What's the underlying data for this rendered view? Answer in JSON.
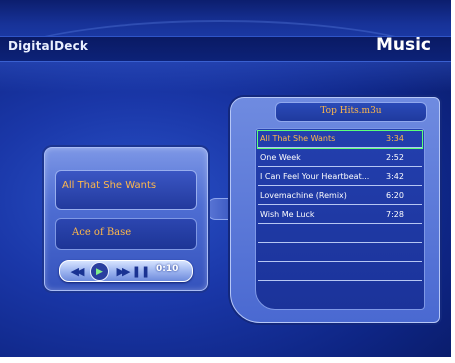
{
  "header": {
    "brand": "DigitalDeck",
    "section": "Music"
  },
  "now_playing": {
    "title": "All That She Wants",
    "artist": "Ace of Base",
    "time": "0:10",
    "controls": [
      "rewind-icon",
      "play-icon",
      "fast-forward-icon",
      "pause-icon"
    ]
  },
  "playlist": {
    "title": "Top Hits.m3u",
    "selected_index": 0,
    "items": [
      {
        "name": "All That She Wants",
        "duration": "3:34"
      },
      {
        "name": "One Week",
        "duration": "2:52"
      },
      {
        "name": "I Can Feel Your Heartbeat...",
        "duration": "3:42"
      },
      {
        "name": "Lovemachine (Remix)",
        "duration": "6:20"
      },
      {
        "name": "Wish Me Luck",
        "duration": "7:28"
      }
    ]
  },
  "colors": {
    "accent_text": "#ffb84a",
    "selection_outline": "#5cff7a",
    "background": "#1a37a8"
  }
}
